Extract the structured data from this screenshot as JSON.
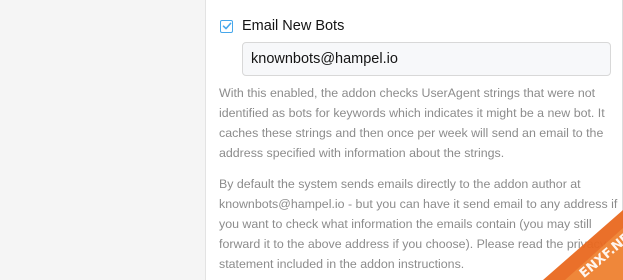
{
  "option": {
    "label": "Email New Bots",
    "checked": true
  },
  "email_input": {
    "value": "knownbots@hampel.io"
  },
  "explain": {
    "paragraph1": "With this enabled, the addon checks UserAgent strings that were not identified as bots for keywords which indicates it might be a new bot. It caches these strings and then once per week will send an email to the address specified with information about the strings.",
    "paragraph2": "By default the system sends emails directly to the addon author at knownbots@hampel.io - but you can have it send email to any address if you want to check what information the emails contain (you may still forward it to the above address if you choose). Please read the privacy statement included in the addon instructions."
  },
  "watermark": {
    "text": "ENXF.NET"
  },
  "colors": {
    "accent": "#47a7eb",
    "muted_text": "#8c8c8c",
    "sidebar_bg": "#f5f5f5",
    "watermark_orange": "#e9681f"
  },
  "icons": {
    "checkbox": "check-icon"
  }
}
